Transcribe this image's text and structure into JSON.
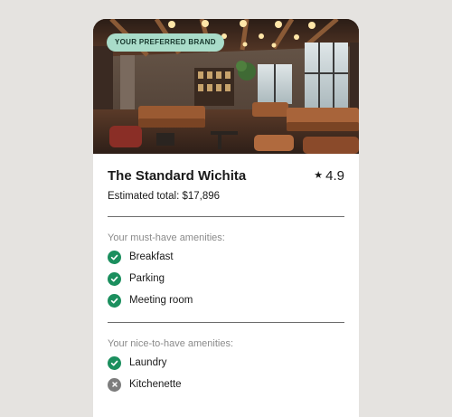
{
  "hotel": {
    "brand_badge": "YOUR PREFERRED BRAND",
    "name": "The Standard Wichita",
    "rating": "4.9",
    "estimated_total": "Estimated total: $17,896",
    "photo_icon": "hotel-lobby-photo"
  },
  "must_have": {
    "heading": "Your must-have amenities:",
    "items": [
      {
        "label": "Breakfast",
        "status": "available"
      },
      {
        "label": "Parking",
        "status": "available"
      },
      {
        "label": "Meeting room",
        "status": "available"
      }
    ]
  },
  "nice_to_have": {
    "heading": "Your nice-to-have amenities:",
    "items": [
      {
        "label": "Laundry",
        "status": "available"
      },
      {
        "label": "Kitchenette",
        "status": "unavailable"
      }
    ]
  },
  "colors": {
    "background": "#e5e3e0",
    "badge": "#a9dcc9",
    "available": "#1b8f5e",
    "unavailable": "#7d7d7d"
  }
}
